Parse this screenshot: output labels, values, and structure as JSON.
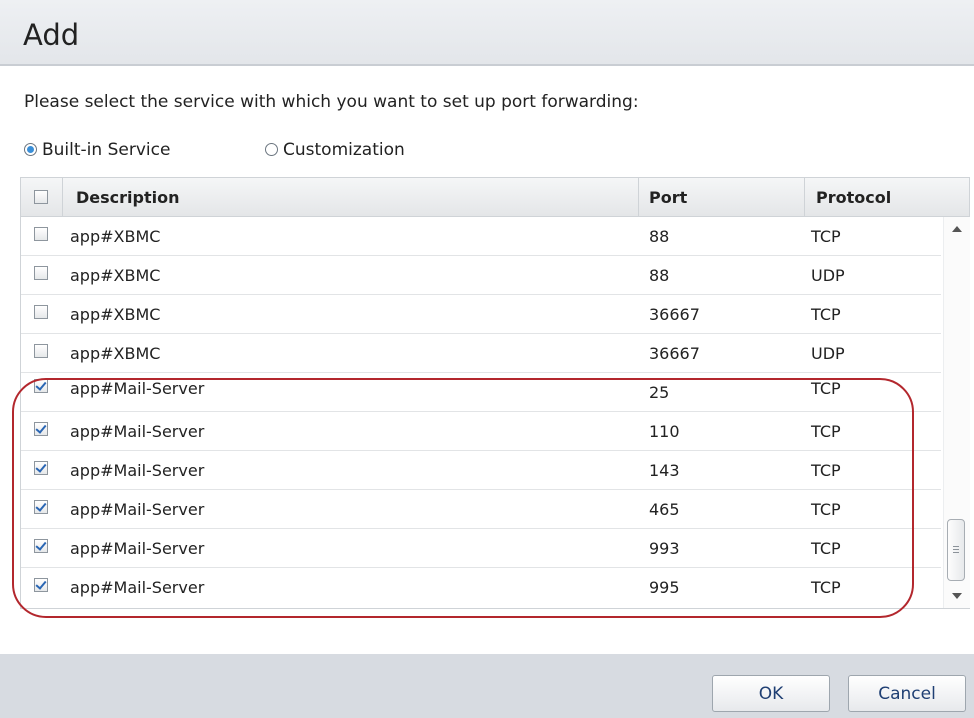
{
  "dialog": {
    "title": "Add"
  },
  "instruction": "Please select the service with which you want to set up port forwarding:",
  "radio": {
    "options": [
      {
        "label": "Built-in Service",
        "selected": true
      },
      {
        "label": "Customization",
        "selected": false
      }
    ]
  },
  "table": {
    "columns": [
      "Description",
      "Port",
      "Protocol"
    ],
    "rows": [
      {
        "description": "app#XBMC",
        "port": "88",
        "protocol": "TCP",
        "checked": false
      },
      {
        "description": "app#XBMC",
        "port": "88",
        "protocol": "UDP",
        "checked": false
      },
      {
        "description": "app#XBMC",
        "port": "36667",
        "protocol": "TCP",
        "checked": false
      },
      {
        "description": "app#XBMC",
        "port": "36667",
        "protocol": "UDP",
        "checked": false
      },
      {
        "description": "app#Mail-Server",
        "port": "25",
        "protocol": "TCP",
        "checked": true
      },
      {
        "description": "app#Mail-Server",
        "port": "110",
        "protocol": "TCP",
        "checked": true
      },
      {
        "description": "app#Mail-Server",
        "port": "143",
        "protocol": "TCP",
        "checked": true
      },
      {
        "description": "app#Mail-Server",
        "port": "465",
        "protocol": "TCP",
        "checked": true
      },
      {
        "description": "app#Mail-Server",
        "port": "993",
        "protocol": "TCP",
        "checked": true
      },
      {
        "description": "app#Mail-Server",
        "port": "995",
        "protocol": "TCP",
        "checked": true
      }
    ]
  },
  "footer": {
    "ok_label": "OK",
    "cancel_label": "Cancel"
  },
  "colors": {
    "highlight": "#b3272d",
    "footer_bg": "#d7dbe1",
    "radio_selected": "#3a8fd8"
  }
}
